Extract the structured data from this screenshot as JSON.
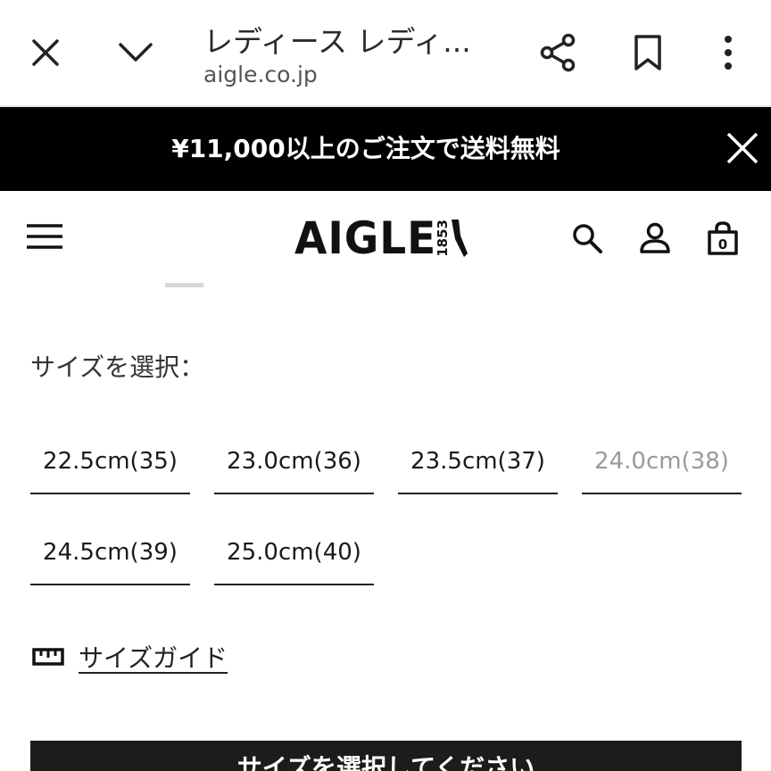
{
  "browser": {
    "title": "レディース レディ...",
    "url": "aigle.co.jp"
  },
  "promo": {
    "text": "¥11,000以上のご注文で送料無料"
  },
  "header": {
    "logo_text": "AIGLE",
    "logo_year": "1853",
    "cart_count": "0"
  },
  "size_select": {
    "label": "サイズを選択：",
    "sizes": [
      {
        "label": "22.5cm(35)",
        "available": true
      },
      {
        "label": "23.0cm(36)",
        "available": true
      },
      {
        "label": "23.5cm(37)",
        "available": true
      },
      {
        "label": "24.0cm(38)",
        "available": false
      },
      {
        "label": "24.5cm(39)",
        "available": true
      },
      {
        "label": "25.0cm(40)",
        "available": true
      }
    ]
  },
  "size_guide": {
    "label": "サイズガイド"
  },
  "cta": {
    "label": "サイズを選択してください"
  },
  "colors": {
    "banner_bg": "#000000",
    "unavailable_text": "#9a9a9a"
  }
}
